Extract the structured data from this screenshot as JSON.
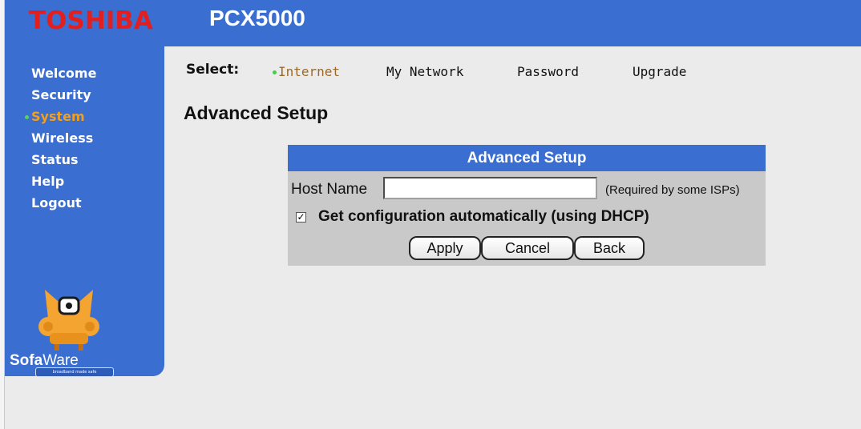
{
  "header": {
    "brand": "TOSHIBA",
    "product": "PCX5000"
  },
  "sidebar": {
    "items": [
      {
        "label": "Welcome",
        "active": false
      },
      {
        "label": "Security",
        "active": false
      },
      {
        "label": "System",
        "active": true
      },
      {
        "label": "Wireless",
        "active": false
      },
      {
        "label": "Status",
        "active": false
      },
      {
        "label": "Help",
        "active": false
      },
      {
        "label": "Logout",
        "active": false
      }
    ],
    "logo": {
      "name_bold": "Sofa",
      "name_regular": "Ware",
      "tagline": "broadband made safe"
    }
  },
  "subnav": {
    "select_label": "Select:",
    "tabs": [
      {
        "label": "Internet",
        "active": true
      },
      {
        "label": "My Network",
        "active": false
      },
      {
        "label": "Password",
        "active": false
      },
      {
        "label": "Upgrade",
        "active": false
      }
    ]
  },
  "page": {
    "title": "Advanced Setup"
  },
  "panel": {
    "header": "Advanced Setup",
    "host_name_label": "Host Name",
    "host_name_value": "",
    "host_name_hint": "(Required by some ISPs)",
    "dhcp_checked": true,
    "dhcp_label": "Get configuration automatically (using DHCP)",
    "buttons": {
      "apply": "Apply",
      "cancel": "Cancel",
      "back": "Back"
    }
  },
  "colors": {
    "accent_blue": "#3a6ed0",
    "brand_red": "#e02020",
    "active_orange": "#f0a020",
    "bullet_green": "#5bd15b"
  },
  "icons": {
    "mascot": "sofa-mascot-icon",
    "bullet": "green-dot-icon"
  }
}
